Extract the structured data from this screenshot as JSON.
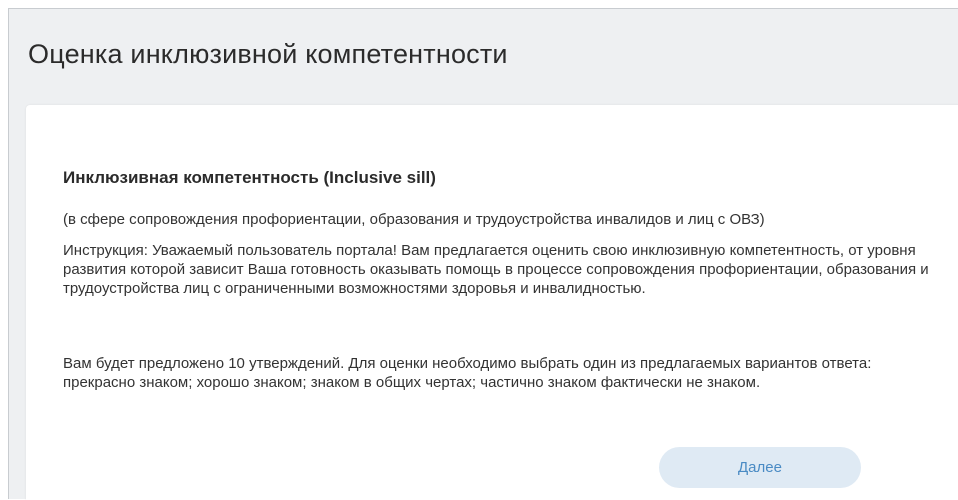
{
  "page": {
    "title": "Оценка инклюзивной компетентности"
  },
  "card": {
    "heading": "Инклюзивная компетентность (Inclusive sill)",
    "subtitle": "(в сфере сопровождения профориентации, образования и трудоустройства инвалидов и лиц с ОВЗ)",
    "instruction": "Инструкция: Уважаемый пользователь портала! Вам предлагается оценить свою инклюзивную компетентность, от уровня развития которой зависит Ваша готовность оказывать помощь в процессе сопровождения профориентации, образования и трудоустройства лиц с ограниченными возможностями здоровья и инвалидностью.",
    "details": "Вам будет предложено 10 утверждений. Для оценки необходимо выбрать один из предлагаемых вариантов ответа: прекрасно знаком; хорошо знаком; знаком в общих чертах; частично знаком фактически не знаком.",
    "next_label": "Далее"
  },
  "colors": {
    "background": "#eef0f2",
    "card": "#ffffff",
    "button_bg": "#dfeaf4",
    "button_text": "#4a8bc4"
  }
}
